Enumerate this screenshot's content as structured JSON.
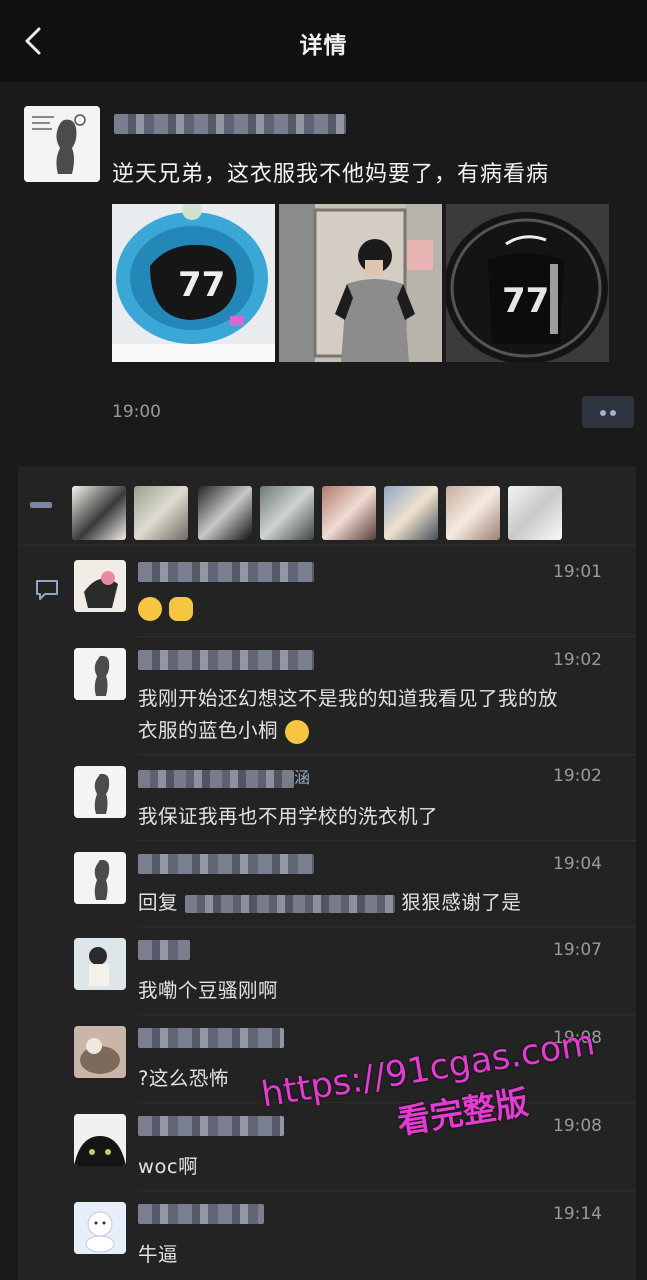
{
  "header": {
    "title": "详情"
  },
  "post": {
    "text": "逆天兄弟，这衣服我不他妈要了，有病看病",
    "time": "19:00",
    "photos": [
      "photo-basket-jersey",
      "photo-mirror-selfie",
      "photo-hanging-jersey"
    ]
  },
  "comments": [
    {
      "time": "19:01",
      "text": ""
    },
    {
      "time": "19:02",
      "text_line1": "我刚开始还幻想这不是我的知道我看见了我的放",
      "text_line2": "衣服的蓝色小桐"
    },
    {
      "time": "19:02",
      "name_suffix": "涵",
      "text": "我保证我再也不用学校的洗衣机了"
    },
    {
      "time": "19:04",
      "text_prefix": "回复",
      "text_suffix": "狠狠感谢了是"
    },
    {
      "time": "19:07",
      "text": "我嘞个豆骚刚啊"
    },
    {
      "time": "19:08",
      "text": "?这么恐怖"
    },
    {
      "time": "19:08",
      "text": "woc啊"
    },
    {
      "time": "19:14",
      "text": "牛逼"
    }
  ],
  "watermark": {
    "line1": "https://91cgas.com",
    "line2": "看完整版"
  },
  "colors": {
    "background": "#111111",
    "panel": "#232323",
    "watermark": "#e43bd0"
  }
}
